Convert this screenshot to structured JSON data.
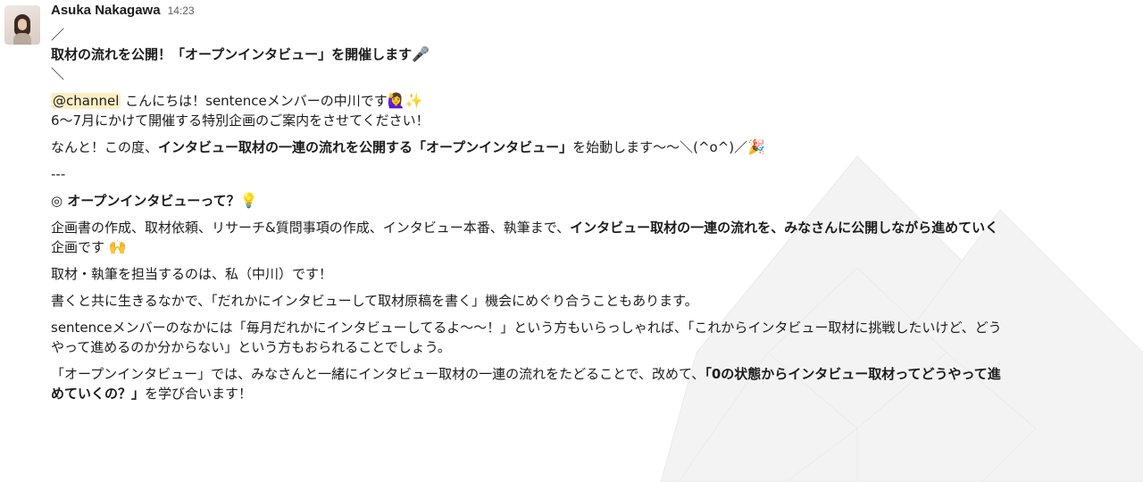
{
  "message": {
    "sender": "Asuka Nakagawa",
    "time": "14:23",
    "lines": {
      "l1": "／",
      "l2_title": "取材の流れを公開！「オープンインタビュー」を開催します",
      "l2_emoji": "🎤",
      "l3": "＼",
      "mention": "@channel",
      "greeting": " こんにちは！sentenceメンバーの中川です",
      "greeting_emoji": "🙋‍♀️✨",
      "intro": "6〜7月にかけて開催する特別企画のご案内をさせてください！",
      "start_a": "なんと！この度、",
      "start_b": "インタビュー取材の一連の流れを公開する「オープンインタビュー」",
      "start_c": "を始動します〜〜＼(^o^)／",
      "start_emoji": "🎉",
      "divider": "---",
      "section_title": "◎ オープンインタビューって？",
      "section_emoji": "💡",
      "p1_a": "企画書の作成、取材依頼、リサーチ&質問事項の作成、インタビュー本番、執筆まで、",
      "p1_b": "インタビュー取材の一連の流れを、みなさんに公開しながら進めていく",
      "p1_c": "企画です",
      "p1_emoji": "🙌",
      "p2": "取材・執筆を担当するのは、私（中川）です！",
      "p3": "書くと共に生きるなかで、「だれかにインタビューして取材原稿を書く」機会にめぐり合うこともあります。",
      "p4_l1": "sentenceメンバーのなかには「毎月だれかにインタビューしてるよ〜〜！」という方もいらっしゃれば、「これからインタビュー取材に挑戦したいけど、どう",
      "p4_l2": "やって進めるのか分からない」という方もおられることでしょう。",
      "p5_a": "「オープンインタビュー」では、みなさんと一緒にインタビュー取材の一連の流れをたどることで、改めて、",
      "p5_b1": "「0の状態からインタビュー取材ってどうやって進",
      "p5_b2": "めていくの？」",
      "p5_c": "を学び合います！"
    }
  },
  "icons": {
    "avatar": "user-avatar-photo",
    "watermark": "mountain-watermark"
  }
}
